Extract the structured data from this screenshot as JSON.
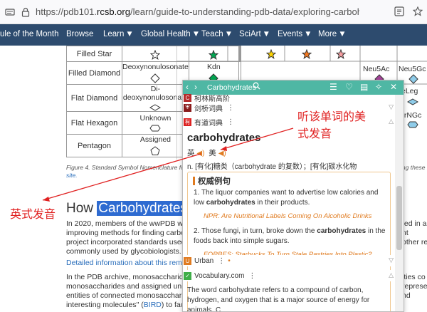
{
  "browser": {
    "url_prefix": "https://pdb101.",
    "url_domain": "rcsb.org",
    "url_path": "/learn/guide-to-understanding-pdb-data/exploring-carbohydrates-in-the"
  },
  "nav": {
    "items": [
      {
        "label": "ule of the Month"
      },
      {
        "label": "Browse"
      },
      {
        "label": "Learn"
      },
      {
        "label": "Global Health"
      },
      {
        "label": "Teach"
      },
      {
        "label": "SciArt"
      },
      {
        "label": "Events"
      },
      {
        "label": "More"
      }
    ]
  },
  "table": {
    "rows": [
      {
        "label": "Filled Star",
        "name": ""
      },
      {
        "label": "Filled Diamond",
        "name": "Deoxynonulosonate",
        "c1": "Kdn",
        "c2": "Neu5Ac",
        "c3": "Neu5Gc"
      },
      {
        "label": "Flat Diamond",
        "name": "Di-deoxynonulosonate",
        "c3": "eLeg"
      },
      {
        "label": "Flat Hexagon",
        "name": "Unknown",
        "c3": "urNGc"
      },
      {
        "label": "Pentagon",
        "name": "Assigned"
      }
    ]
  },
  "caption": {
    "left": "Figure 4. Standard Symbol Nomenclature fo",
    "right": "ing these sy",
    "link": "site."
  },
  "article": {
    "heading_pre": "How ",
    "heading_highlight": "Carbohydrates",
    "heading_post": " ar",
    "p1": [
      "In 2020, members of the wwPDB work",
      "improving methods for finding carbo",
      "project incorporated standards used b",
      "commonly used by glycobiologists."
    ],
    "p1_right": [
      "ted in a",
      "nt",
      "other repo"
    ],
    "link_line": "Detailed information about this remed",
    "p2": [
      "In the PDB archive, monosaccharides",
      "monosaccharides and assigned uniqu",
      "entities of connected monosaccharide",
      "interesting molecules\" ("
    ],
    "p2_link": "BIRD",
    "p2_after": ") to facilit",
    "p2_right": [
      "ities co",
      "represe",
      "",
      "nd"
    ]
  },
  "annotations": {
    "right": [
      "听该单词的美",
      "式发音"
    ],
    "left": "英式发音"
  },
  "dict": {
    "title": "Carbohydrates",
    "sources": [
      "柯林斯高阶",
      "剑桥词典",
      "有道词典"
    ],
    "headword": "carbohydrates",
    "uk_label": "英",
    "us_label": "美",
    "definition": "n. [有化]糖类（carbohydrate 的复数）；[有化]碳水化物",
    "examples_title": "权威例句",
    "examples": [
      {
        "num": "1.",
        "text_pre": "The liquor companies want to advertise low calories and low ",
        "bold": "carbohydrates",
        "text_post": " in their products.",
        "src": "NPR: Are Nutritional Labels Coming On Alcoholic Drinks"
      },
      {
        "num": "2.",
        "text_pre": "Those fungi, in turn, broke down the ",
        "bold": "carbohydrates",
        "text_post": " in the foods back into simple sugars.",
        "src": "FORBES: Starbucks To Turn Stale Pastries Into Plastic?"
      }
    ],
    "urban": "Urban",
    "vocab": "Vocabulary.com",
    "vocab_text": "The word carbohydrate refers to a compound of carbon, hydrogen, and oxygen that is a major source of energy for animals. C"
  },
  "colors": {
    "nav_bg": "#2d4b6e",
    "dict_header": "#4fb7a4",
    "highlight": "#2e6bd1",
    "annotation": "#e02020"
  }
}
